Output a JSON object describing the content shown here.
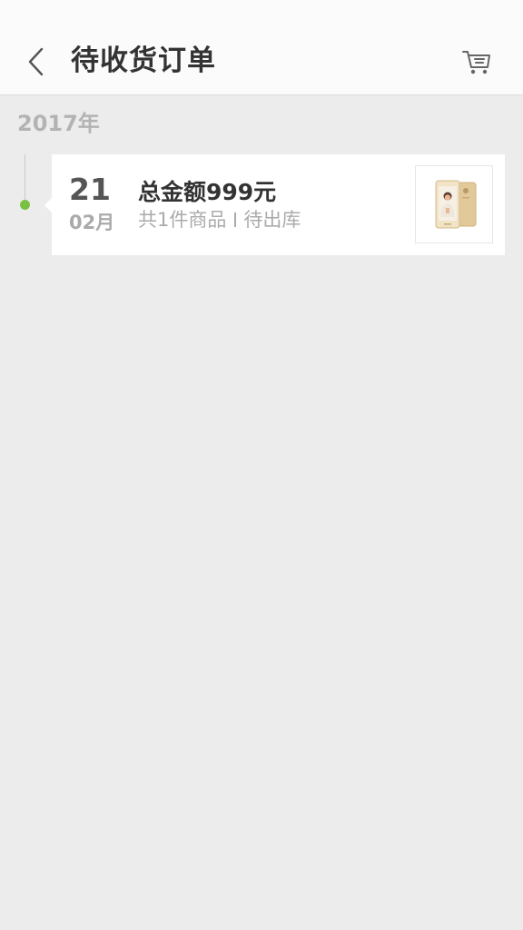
{
  "header": {
    "title": "待收货订单",
    "back_icon": "chevron-left-icon",
    "cart_icon": "shopping-cart-icon"
  },
  "timeline": {
    "year": "2017年",
    "dot_color": "#7ac143"
  },
  "orders": [
    {
      "day": "21",
      "month": "02月",
      "total": "总金额999元",
      "count": "共1件商品",
      "status": "待出库",
      "product_image": "phone-product-thumbnail"
    }
  ]
}
